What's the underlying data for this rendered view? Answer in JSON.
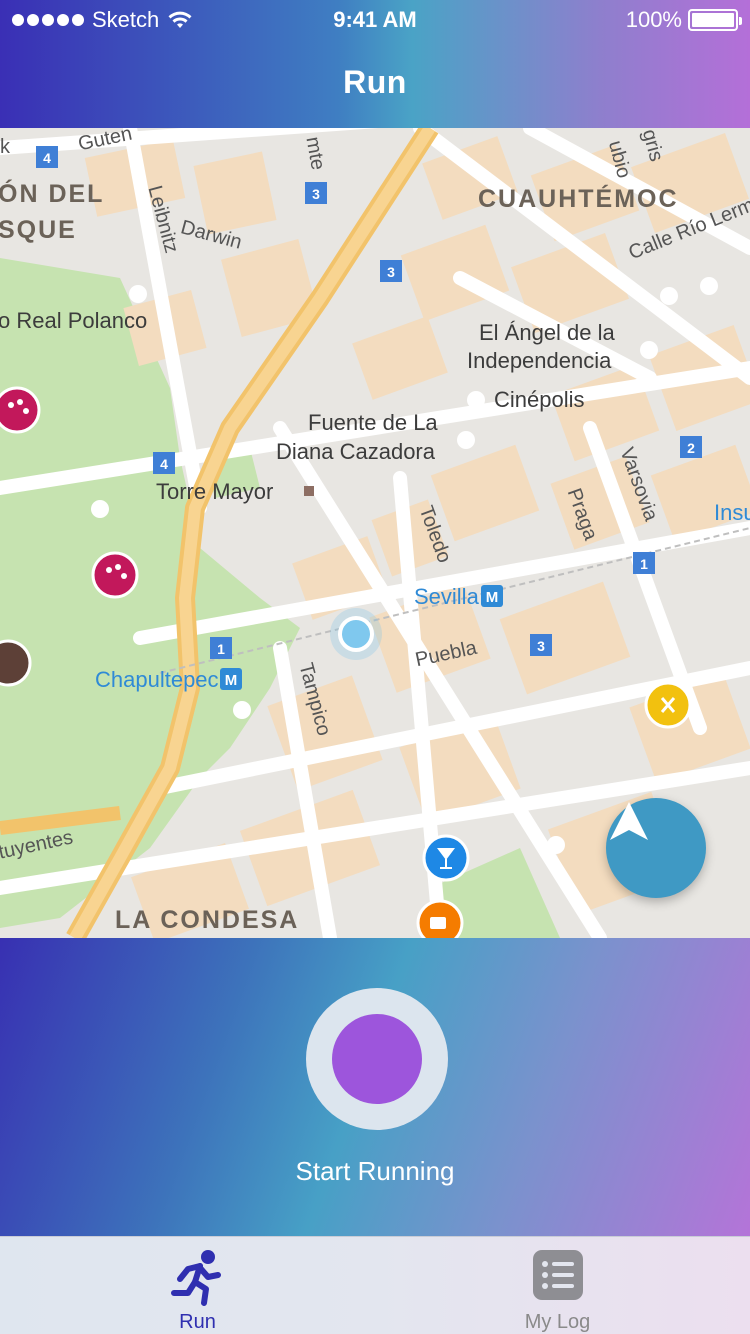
{
  "status_bar": {
    "carrier": "Sketch",
    "time": "9:41 AM",
    "battery": "100%",
    "battery_level": 1.0
  },
  "header": {
    "title": "Run"
  },
  "map": {
    "labels": {
      "district_cuauhtemoc": "CUAUHTÉMOC",
      "district_bosque_1": "ÓN DEL",
      "district_bosque_2": "SQUE",
      "district_condesa": "LA CONDESA",
      "polanco": "o Real Polanco",
      "angel_1": "El Ángel de la",
      "angel_2": "Independencia",
      "cinepolis": "Cinépolis",
      "diana_1": "Fuente de La",
      "diana_2": "Diana Cazadora",
      "torre": "Torre Mayor",
      "sevilla": "Sevilla",
      "chapultepec": "Chapultepec",
      "puebla": "Puebla",
      "tampico": "Tampico",
      "toledo": "Toledo",
      "praga": "Praga",
      "varsovia": "Varsovia",
      "leibnitz": "Leibnitz",
      "darwin": "Darwin",
      "calle_rio": "Calle Río Lerm",
      "gutenberg": "Guten",
      "insurgentes": "Insu",
      "constituyentes": "tuyentes",
      "rubio": "ubio",
      "gris": "gris",
      "mte": "mte",
      "k": "k"
    },
    "route_badges": [
      "4",
      "3",
      "3",
      "4",
      "2",
      "1",
      "1",
      "3"
    ],
    "metro_glyph": "M"
  },
  "run_panel": {
    "start_label": "Start Running"
  },
  "tabs": [
    {
      "label": "Run",
      "active": true
    },
    {
      "label": "My Log",
      "active": false
    }
  ],
  "colors": {
    "accent": "#9d55dc",
    "locate": "#3f99c4",
    "active_tab": "#2f2fb0"
  }
}
